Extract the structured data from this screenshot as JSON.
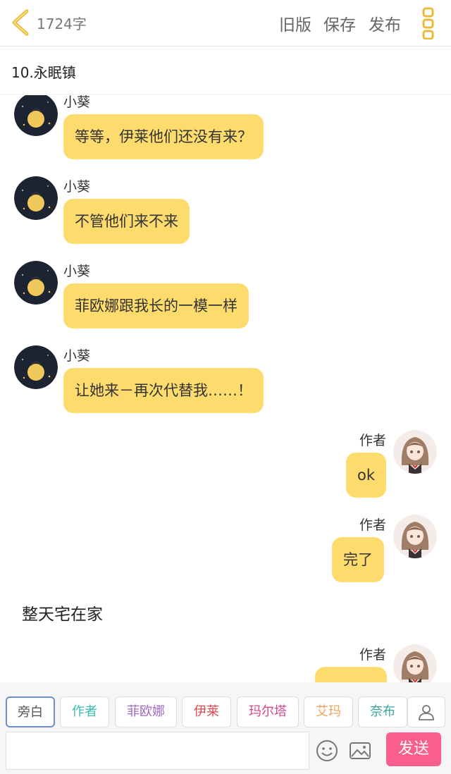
{
  "header": {
    "word_count": "1724字",
    "old_version_label": "旧版",
    "save_label": "保存",
    "publish_label": "发布"
  },
  "chapter": {
    "title": "10.永眠镇"
  },
  "messages": [
    {
      "speaker": "小葵",
      "text": "等等，伊莱他们还没有来？"
    },
    {
      "speaker": "小葵",
      "text": "不管他们来不来"
    },
    {
      "speaker": "小葵",
      "text": "菲欧娜跟我长的一模一样"
    },
    {
      "speaker": "小葵",
      "text": "让她来－再次代替我……！"
    },
    {
      "speaker": "作者",
      "text": "ok"
    },
    {
      "speaker": "作者",
      "text": "完了"
    },
    {
      "narration": "整天宅在家"
    },
    {
      "speaker": "作者",
      "text": ""
    }
  ],
  "roles": [
    {
      "label": "旁白",
      "color": "#555555"
    },
    {
      "label": "作者",
      "color": "#3bb8b0"
    },
    {
      "label": "菲欧娜",
      "color": "#a26ac4"
    },
    {
      "label": "伊莱",
      "color": "#e0474c"
    },
    {
      "label": "玛尔塔",
      "color": "#d6458b"
    },
    {
      "label": "艾玛",
      "color": "#f0a35a"
    },
    {
      "label": "奈布",
      "color": "#3aa6a0"
    }
  ],
  "input": {
    "value": "",
    "send_label": "发送"
  },
  "icons": {
    "back": "chevron-left-icon",
    "more": "more-vertical-icon",
    "add_role": "person-icon",
    "emoji": "smiley-icon",
    "image": "image-icon"
  },
  "colors": {
    "bubble": "#fddc6d",
    "send": "#f95e8e",
    "accent": "#e8b93a"
  }
}
